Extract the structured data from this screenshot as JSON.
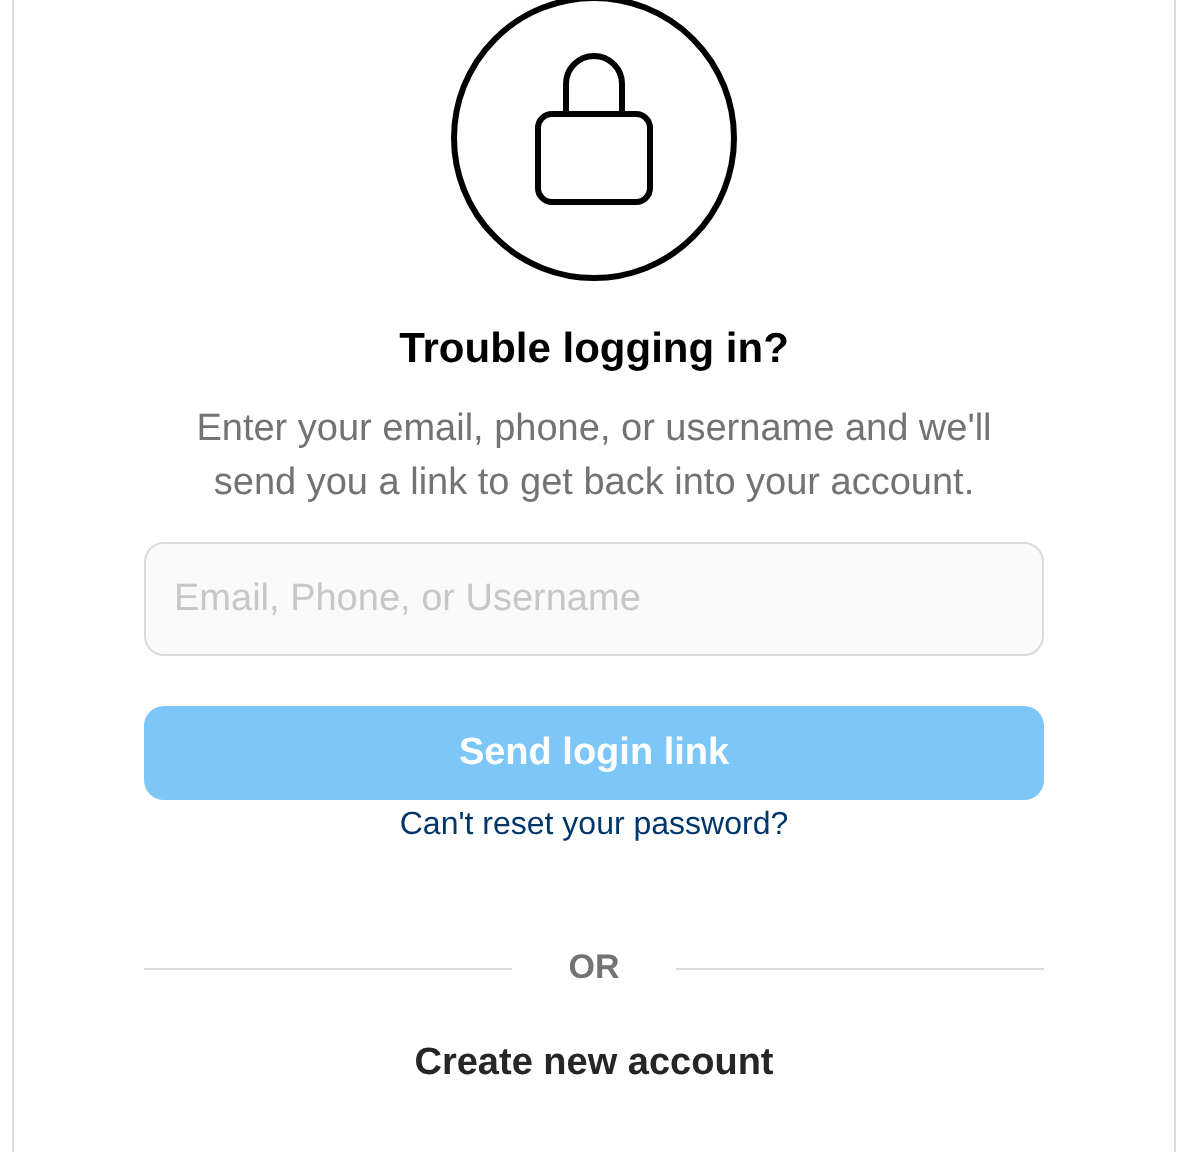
{
  "title": "Trouble logging in?",
  "description": "Enter your email, phone, or username and we'll send you a link to get back into your account.",
  "field": {
    "placeholder": "Email, Phone, or Username"
  },
  "send_button": {
    "label": "Send login link",
    "disabled": true
  },
  "reset_link": "Can't reset your password?",
  "divider": "OR",
  "create_link": "Create new account"
}
